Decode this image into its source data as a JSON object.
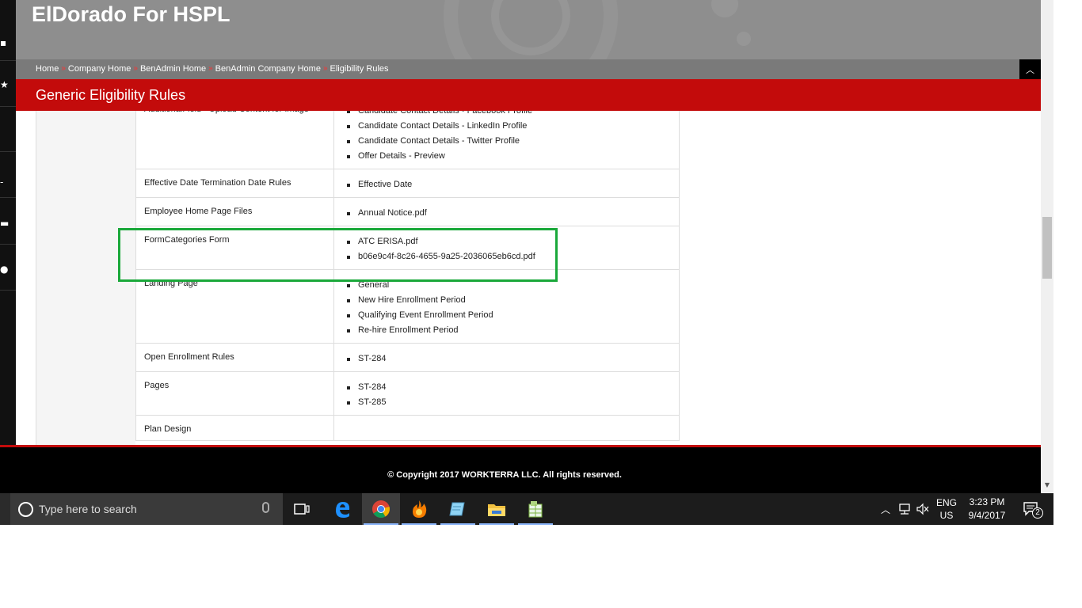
{
  "header": {
    "site_title": "ElDorado For HSPL"
  },
  "breadcrumb": {
    "items": [
      "Home",
      "Company Home",
      "BenAdmin Home",
      "BenAdmin Company Home",
      "Eligibility Rules"
    ],
    "separator": "»"
  },
  "page": {
    "title": "Generic Eligibility Rules"
  },
  "rules_table": {
    "rows": [
      {
        "name": "AdditionalField - Upload Content for Image",
        "items": [
          "Candidate Contact Details - Facebook Profile",
          "Candidate Contact Details - LinkedIn Profile",
          "Candidate Contact Details - Twitter Profile",
          "Offer Details - Preview"
        ]
      },
      {
        "name": "Effective Date Termination Date Rules",
        "items": [
          "Effective Date"
        ]
      },
      {
        "name": "Employee Home Page Files",
        "items": [
          "Annual Notice.pdf"
        ]
      },
      {
        "name": "FormCategories Form",
        "items": [
          "ATC ERISA.pdf",
          "b06e9c4f-8c26-4655-9a25-2036065eb6cd.pdf"
        ]
      },
      {
        "name": "Landing Page",
        "items": [
          "General",
          "New Hire Enrollment Period",
          "Qualifying Event Enrollment Period",
          "Re-hire Enrollment Period"
        ]
      },
      {
        "name": "Open Enrollment Rules",
        "items": [
          "ST-284"
        ]
      },
      {
        "name": "Pages",
        "items": [
          "ST-284",
          "ST-285"
        ]
      },
      {
        "name": "Plan Design",
        "items": []
      }
    ]
  },
  "footer": {
    "copyright": "© Copyright 2017 WORKTERRA LLC. All rights reserved."
  },
  "taskbar": {
    "search_placeholder": "Type here to search",
    "language_top": "ENG",
    "language_bottom": "US",
    "time": "3:23 PM",
    "date": "9/4/2017",
    "notification_count": "2"
  },
  "colors": {
    "accent_red": "#c30b0b",
    "highlight_green": "#1aa83a",
    "header_gray": "#8e8e8e"
  }
}
